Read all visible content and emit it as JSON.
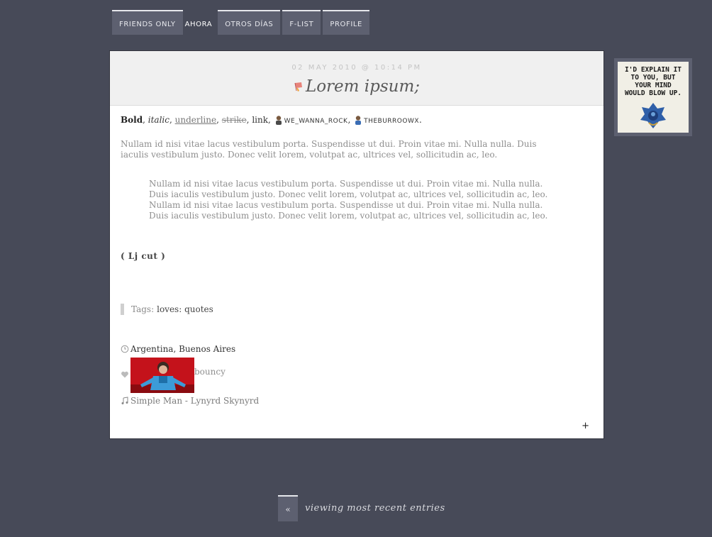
{
  "nav": {
    "items": [
      {
        "label": "FRIENDS ONLY",
        "active": false
      },
      {
        "label": "AHORA",
        "active": true
      },
      {
        "label": "OTROS DÍAS",
        "active": false
      },
      {
        "label": "F-LIST",
        "active": false
      },
      {
        "label": "PROFILE",
        "active": false
      }
    ]
  },
  "entry": {
    "date": "02 MAY 2010 @ 10:14 PM",
    "title": "Lorem ipsum;",
    "format": {
      "bold": "Bold",
      "italic": "italic",
      "underline": "underline",
      "strike": "strike",
      "link": "link",
      "user1": "WE_WANNA_ROCK",
      "user2": "THEBURROOWX",
      "comma": ", ",
      "period": "."
    },
    "paragraph": "Nullam id nisi vitae lacus vestibulum porta. Suspendisse ut dui. Proin vitae mi. Nulla nulla. Duis iaculis vestibulum justo. Donec velit lorem, volutpat ac, ultrices vel, sollicitudin ac, leo.",
    "blockquote": "Nullam id nisi vitae lacus vestibulum porta. Suspendisse ut dui. Proin vitae mi. Nulla nulla. Duis iaculis vestibulum justo. Donec velit lorem, volutpat ac, ultrices vel, sollicitudin ac, leo. Nullam id nisi vitae lacus vestibulum porta. Suspendisse ut dui. Proin vitae mi. Nulla nulla. Duis iaculis vestibulum justo. Donec velit lorem, volutpat ac, ultrices vel, sollicitudin ac, leo.",
    "lj_cut": "( Lj cut )",
    "tags_label": "Tags:",
    "tags_value": "loves: quotes",
    "location": "Argentina, Buenos Aires",
    "mood": "bouncy",
    "music": "Simple Man - Lynyrd Skynyrd",
    "expand": "+"
  },
  "userpic": {
    "text_lines": [
      "I'D EXPLAIN IT",
      "TO YOU, BUT",
      "YOUR MIND",
      "WOULD BLOW UP."
    ]
  },
  "pager": {
    "prev": "«",
    "status": "viewing most recent entries"
  },
  "colors": {
    "background": "#474a58",
    "nav_tab": "#5d6070",
    "entry_header": "#f0f0f0"
  }
}
